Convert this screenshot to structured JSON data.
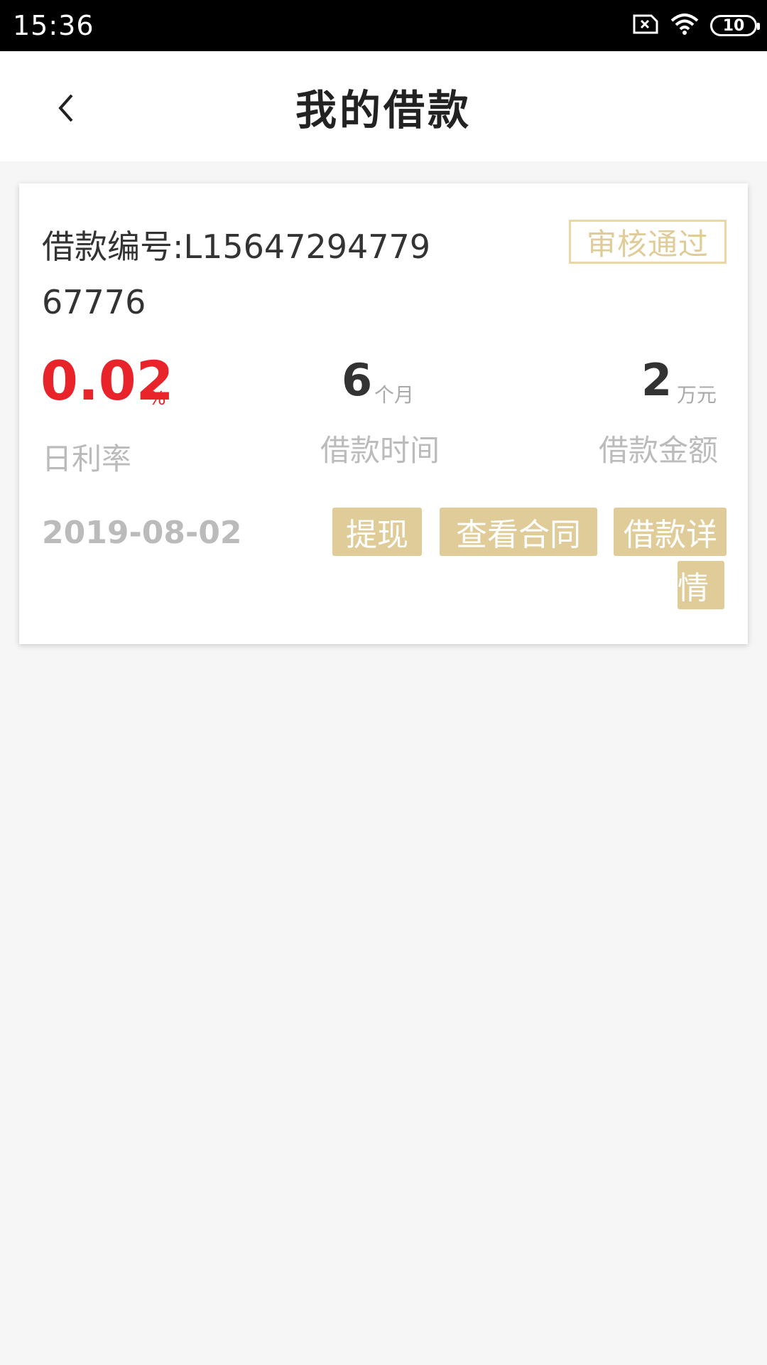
{
  "status_bar": {
    "time": "15:36",
    "battery": "10"
  },
  "header": {
    "title": "我的借款"
  },
  "loan_card": {
    "loan_number": "借款编号:L1564729477967776",
    "status": "审核通过",
    "daily_rate": "0.02",
    "daily_rate_unit": "%",
    "daily_rate_label": "日利率",
    "term": "6",
    "term_unit": "个月",
    "term_label": "借款时间",
    "amount": "2",
    "amount_unit": "万元",
    "amount_label": "借款金额",
    "date": "2019-08-02",
    "buttons": {
      "withdraw": "提现",
      "view_contract": "查看合同",
      "loan_detail_line1": "借款详",
      "loan_detail_line2": "情"
    }
  },
  "colors": {
    "rate_red": "#e8232a",
    "gold": "#dfcc98",
    "badge_border": "#e9d7a6"
  }
}
